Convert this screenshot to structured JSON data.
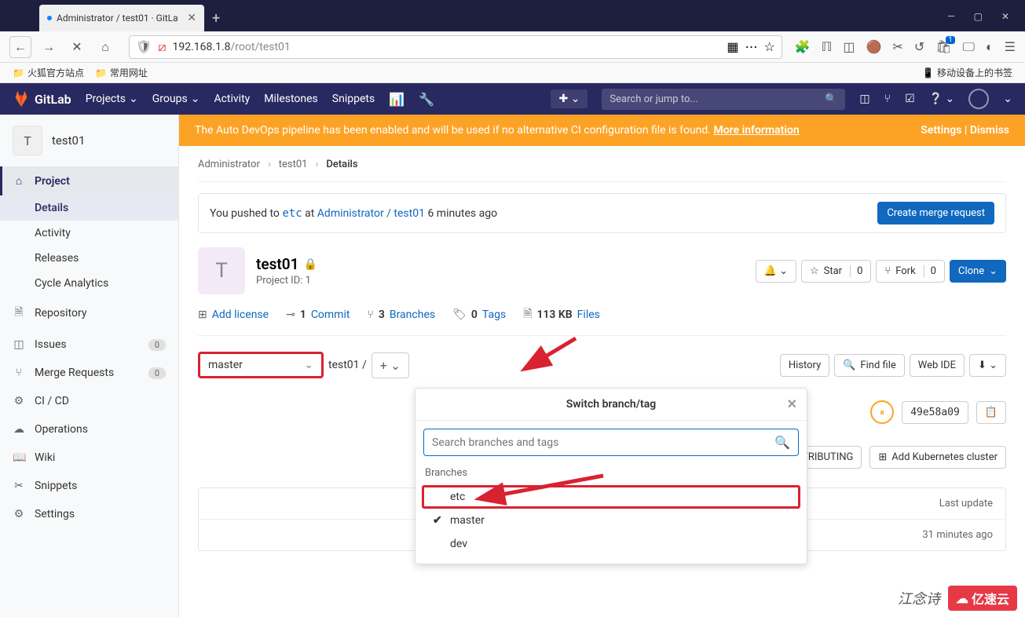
{
  "browser": {
    "tab_title": "Administrator / test01 · GitLa",
    "url_domain": "192.168.1.8",
    "url_path": "/root/test01",
    "bookmarks": {
      "firefox": "火狐官方站点",
      "common": "常用网址",
      "mobile": "移动设备上的书签"
    },
    "window_min": "—",
    "window_max": "▢",
    "window_close": "✕"
  },
  "gitlab": {
    "brand": "GitLab",
    "nav": {
      "projects": "Projects",
      "groups": "Groups",
      "activity": "Activity",
      "milestones": "Milestones",
      "snippets": "Snippets"
    },
    "search_placeholder": "Search or jump to..."
  },
  "sidebar": {
    "project_initial": "T",
    "project_name": "test01",
    "items": {
      "project": "Project",
      "details": "Details",
      "activity": "Activity",
      "releases": "Releases",
      "cycle": "Cycle Analytics",
      "repository": "Repository",
      "issues": "Issues",
      "issues_count": "0",
      "merge_requests": "Merge Requests",
      "mr_count": "0",
      "cicd": "CI / CD",
      "operations": "Operations",
      "wiki": "Wiki",
      "snippets": "Snippets",
      "settings": "Settings"
    }
  },
  "banner": {
    "text": "The Auto DevOps pipeline has been enabled and will be used if no alternative CI configuration file is found. ",
    "more": "More information",
    "settings": "Settings",
    "dismiss": "Dismiss"
  },
  "breadcrumb": {
    "admin": "Administrator",
    "project": "test01",
    "page": "Details"
  },
  "push_notice": {
    "prefix": "You pushed to ",
    "branch": "etc",
    "at": " at ",
    "link": "Administrator / test01",
    "time": " 6 minutes ago",
    "button": "Create merge request"
  },
  "project": {
    "avatar": "T",
    "name": "test01",
    "id_label": "Project ID: 1",
    "notify": "🔔",
    "star": "Star",
    "star_count": "0",
    "fork": "Fork",
    "fork_count": "0",
    "clone": "Clone"
  },
  "stats": {
    "license": "Add license",
    "commits_n": "1",
    "commits": "Commit",
    "branches_n": "3",
    "branches": "Branches",
    "tags_n": "0",
    "tags": "Tags",
    "size_n": "113 KB",
    "size": "Files"
  },
  "branch_row": {
    "selected": "master",
    "path": "test01",
    "history": "History",
    "find": "Find file",
    "webide": "Web IDE"
  },
  "dropdown": {
    "title": "Switch branch/tag",
    "search_placeholder": "Search branches and tags",
    "section": "Branches",
    "items": [
      "etc",
      "master",
      "dev"
    ],
    "checked": "master"
  },
  "commit": {
    "hash": "49e58a09"
  },
  "setup": {
    "contributing": "Add CONTRIBUTING",
    "kubernetes": "Add Kubernetes cluster"
  },
  "table": {
    "last_update": "Last update",
    "time": "31 minutes ago"
  },
  "watermark": {
    "text": "江念诗",
    "logo": "亿速云"
  }
}
